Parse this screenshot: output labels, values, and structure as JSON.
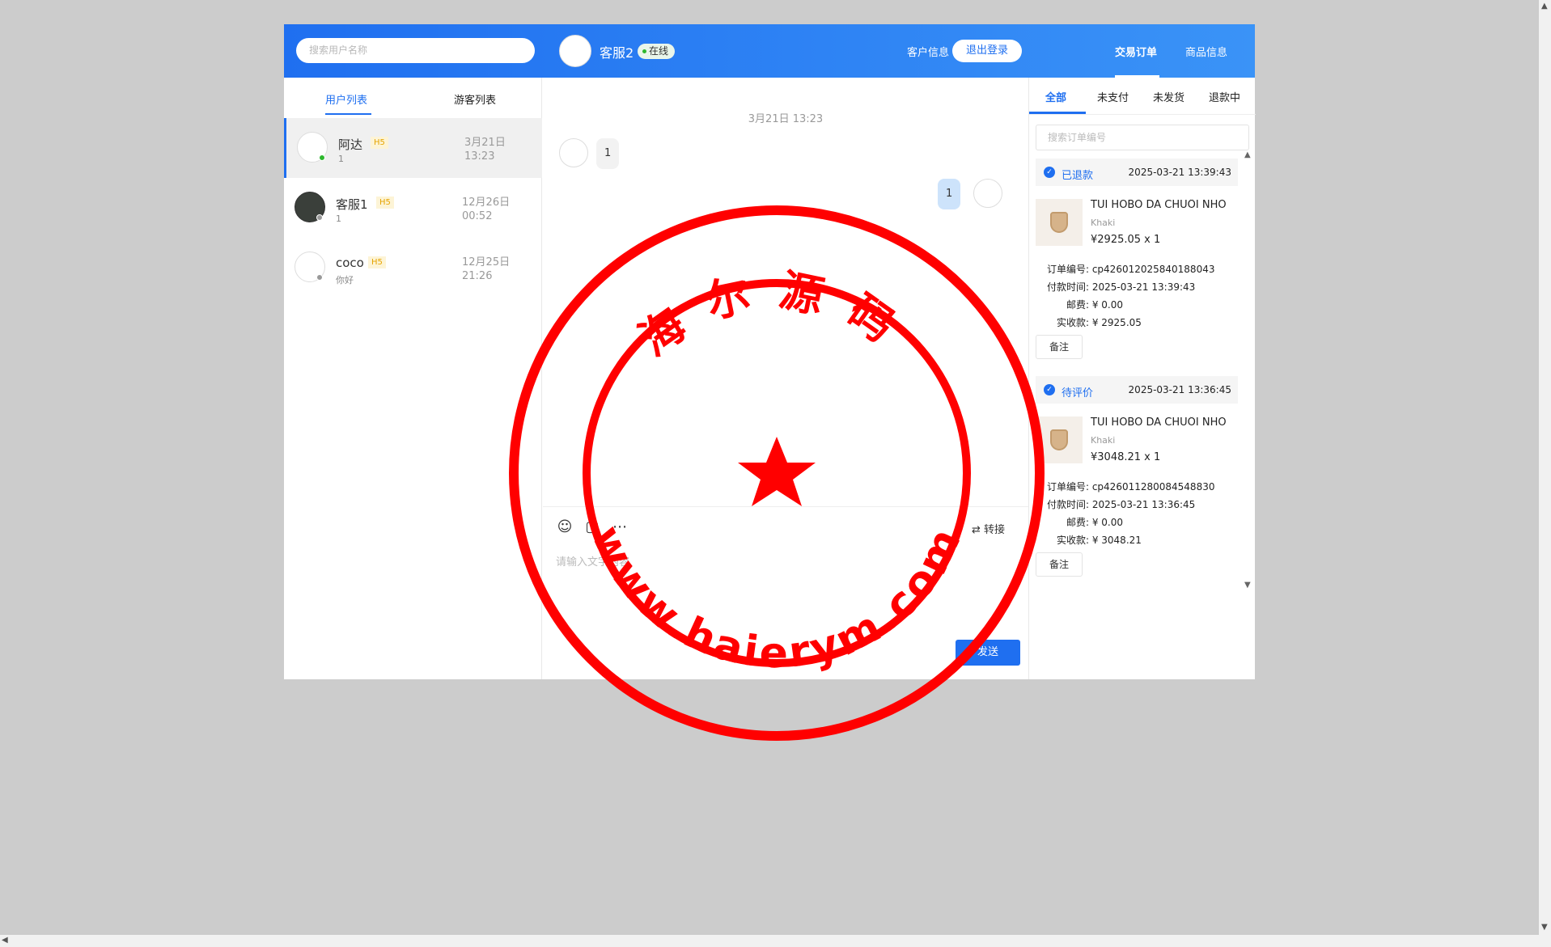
{
  "header": {
    "search_placeholder": "搜索用户名称",
    "agent_name": "客服2",
    "agent_status": "在线",
    "logout_label": "退出登录",
    "nav": [
      {
        "label": "客户信息"
      },
      {
        "label": "交易订单",
        "active": true
      },
      {
        "label": "商品信息"
      }
    ]
  },
  "left": {
    "tabs": [
      {
        "label": "用户列表",
        "active": true
      },
      {
        "label": "游客列表"
      }
    ],
    "users": [
      {
        "name": "阿达",
        "tag": "H5",
        "last_message": "1",
        "date": "3月21日",
        "time": "13:23",
        "online": true
      },
      {
        "name": "客服1",
        "tag": "H5",
        "last_message": "1",
        "date": "12月26日",
        "time": "00:52",
        "online": false
      },
      {
        "name": "coco",
        "tag": "H5",
        "last_message": "你好",
        "date": "12月25日",
        "time": "21:26",
        "online": false
      }
    ]
  },
  "chat": {
    "timestamp": "3月21日 13:23",
    "messages": [
      {
        "from": "user",
        "text": "1"
      },
      {
        "from": "agent",
        "text": "1"
      }
    ],
    "composer": {
      "placeholder": "请输入文字内容",
      "transfer_label": "转接",
      "send_label": "发送"
    }
  },
  "orders": {
    "tabs": [
      {
        "label": "全部",
        "active": true
      },
      {
        "label": "未支付"
      },
      {
        "label": "未发货"
      },
      {
        "label": "退款中"
      }
    ],
    "search_placeholder": "搜索订单编号",
    "list": [
      {
        "status": "已退款",
        "time": "2025-03-21 13:39:43",
        "title": "TÚI HOBO DA CHUỖI NHỎ",
        "color": "Khaki",
        "price": "¥2925.05 x 1",
        "order_label": "订单编号:",
        "order_no": "cp426012025840188043",
        "pay_label": "付款时间:",
        "pay_time": "2025-03-21 13:39:43",
        "shipping_label": "邮费:",
        "shipping": "¥ 0.00",
        "received_label": "实收款:",
        "received": "¥ 2925.05",
        "remark_label": "备注"
      },
      {
        "status": "待评价",
        "time": "2025-03-21 13:36:45",
        "title": "TÚI HOBO DA CHUỖI NHỎ",
        "color": "Khaki",
        "price": "¥3048.21 x 1",
        "order_label": "订单编号:",
        "order_no": "cp426011280084548830",
        "pay_label": "付款时间:",
        "pay_time": "2025-03-21 13:36:45",
        "shipping_label": "邮费:",
        "shipping": "¥ 0.00",
        "received_label": "实收款:",
        "received": "¥ 3048.21",
        "remark_label": "备注"
      }
    ]
  },
  "watermark": {
    "top_text": "海尔源码",
    "bottom_text": "www.haierym.com"
  },
  "colors": {
    "primary": "#1f6ff0",
    "header_gradient_end": "#3a93f7",
    "stamp_red": "#ff0000",
    "tag_bg": "#fdf4d6",
    "tag_text": "#e6a400"
  }
}
